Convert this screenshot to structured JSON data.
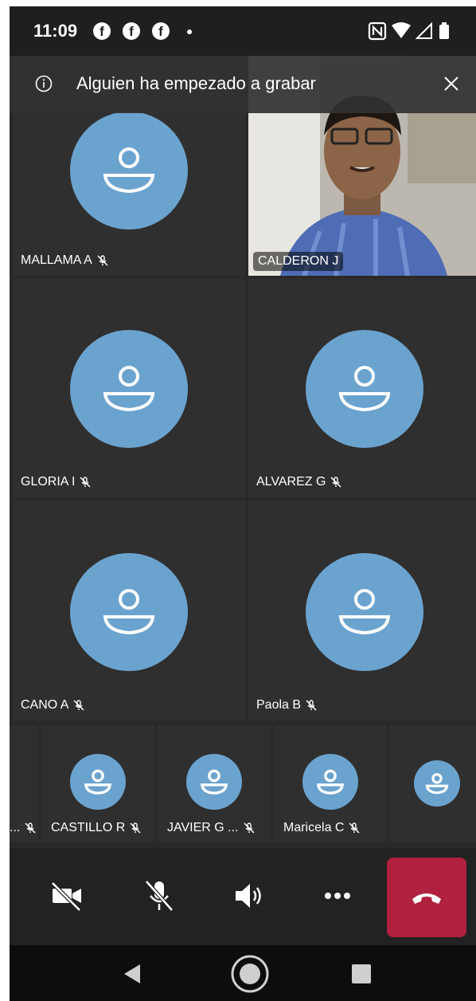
{
  "status_bar": {
    "time": "11:09",
    "notification_icons": [
      "facebook-icon",
      "facebook-icon",
      "facebook-icon",
      "dot-icon"
    ],
    "right_icons": [
      "nfc-icon",
      "wifi-icon",
      "cell-signal-icon",
      "battery-icon"
    ]
  },
  "banner": {
    "text": "Alguien ha empezado a grabar",
    "icon": "info-icon",
    "close_icon": "close-icon"
  },
  "participants_main": [
    {
      "name": "MALLAMA A",
      "muted": true,
      "video": false
    },
    {
      "name": "CALDERON J",
      "muted": false,
      "video": true
    },
    {
      "name": "GLORIA I",
      "muted": true,
      "video": false
    },
    {
      "name": "ALVAREZ G",
      "muted": true,
      "video": false
    },
    {
      "name": "CANO A",
      "muted": true,
      "video": false
    },
    {
      "name": "Paola B",
      "muted": true,
      "video": false
    }
  ],
  "participants_row": [
    {
      "name": "...",
      "muted": true
    },
    {
      "name": "CASTILLO R",
      "muted": true
    },
    {
      "name": "JAVIER G ...",
      "muted": true
    },
    {
      "name": "Maricela C",
      "muted": true
    },
    {
      "name": "",
      "muted": false
    }
  ],
  "controls": [
    {
      "name": "camera-off-icon"
    },
    {
      "name": "mic-off-icon"
    },
    {
      "name": "speaker-icon"
    },
    {
      "name": "more-icon"
    },
    {
      "name": "hang-up-icon",
      "color": "#b0203f"
    }
  ],
  "colors": {
    "background": "#292929",
    "tile": "#2f2f2f",
    "avatar": "#6ba3cf",
    "hangup": "#b0203f"
  }
}
